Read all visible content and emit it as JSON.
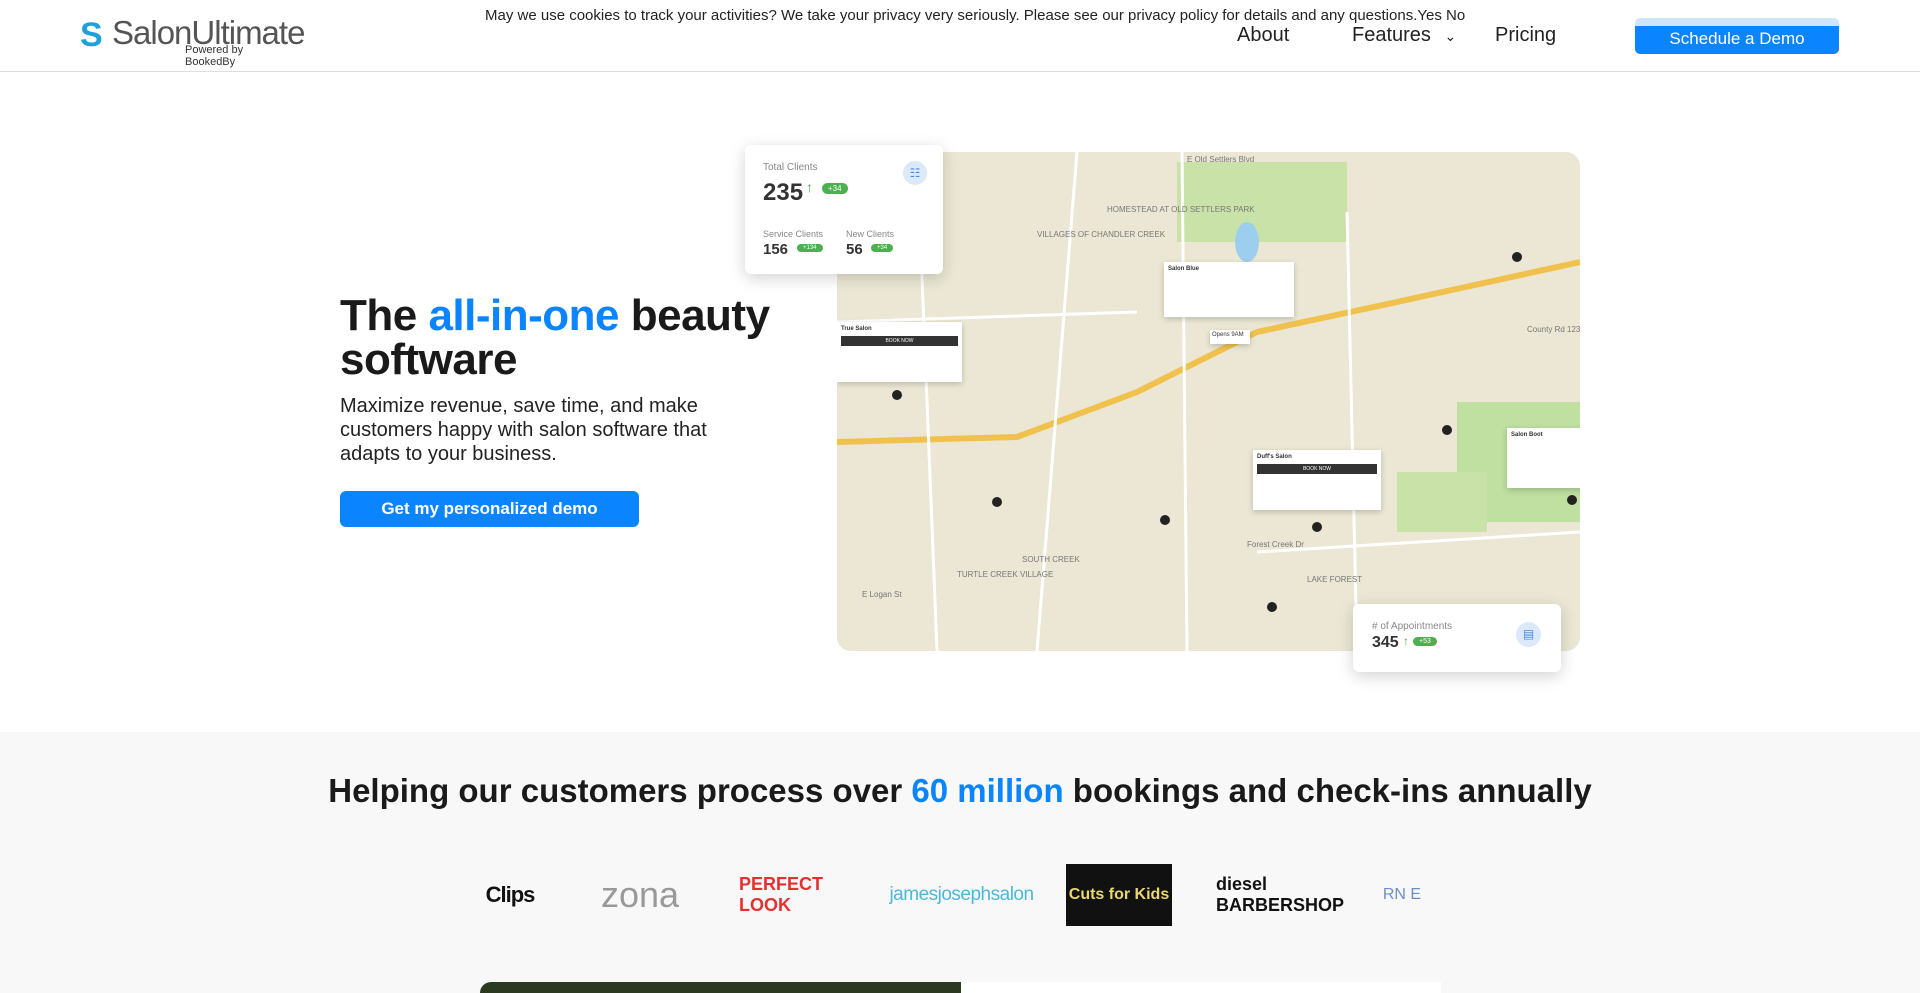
{
  "header": {
    "logo_name": "SalonUltimate",
    "logo_sub": "Powered by BookedBy",
    "cookie_text": "May we use cookies to track your activities? We take your privacy very seriously. Please see our privacy policy for details and any questions.",
    "cookie_yes": "Yes",
    "cookie_no": "No",
    "nav": [
      "About",
      "Features",
      "Pricing"
    ],
    "cta": "Schedule a Demo"
  },
  "hero": {
    "title_a": "The ",
    "title_b": "all-in-one",
    "title_c": " beauty software",
    "subtitle": "Maximize revenue, save time, and make customers happy with salon software that adapts to your business.",
    "button": "Get my personalized demo",
    "accent": "#0a84ff"
  },
  "stats": {
    "total_label": "Total Clients",
    "total": "235",
    "total_delta": "+34",
    "service_label": "Service Clients",
    "service": "156",
    "service_delta": "+134",
    "new_label": "New Clients",
    "new": "56",
    "new_delta": "+34",
    "appt_label": "# of Appointments",
    "appt": "345",
    "appt_delta": "+53"
  },
  "map": {
    "salons": [
      "True Salon",
      "Salon Blue",
      "Duff's Salon",
      "Salon Boot"
    ],
    "open_badge": "Opens 9AM",
    "book": "BOOK NOW",
    "labels": [
      "VILLAGES OF CHANDLER CREEK",
      "HOMESTEAD AT OLD SETTLERS PARK",
      "TURTLE CREEK VILLAGE",
      "SOUTH CREEK",
      "LAKE FOREST",
      "E Old Settlers Blvd",
      "County Rd 123",
      "Forest Creek Dr",
      "E Logan St"
    ]
  },
  "customers": {
    "heading_a": "Helping our customers process over ",
    "heading_b": "60 million",
    "heading_c": " bookings and check-ins annually",
    "logos": [
      "Clips",
      "zona",
      "PERFECT LOOK",
      "jamesjosephsalon",
      "Cuts for Kids",
      "diesel BARBERSHOP",
      "RN E"
    ]
  }
}
